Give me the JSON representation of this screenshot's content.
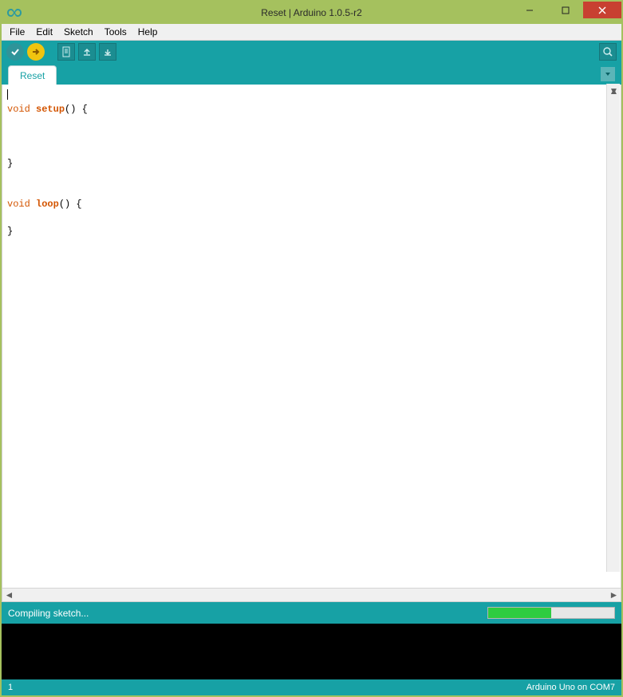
{
  "window": {
    "title": "Reset | Arduino 1.0.5-r2"
  },
  "menu": {
    "items": [
      "File",
      "Edit",
      "Sketch",
      "Tools",
      "Help"
    ]
  },
  "toolbar": {
    "verify_icon": "verify-icon",
    "upload_icon": "upload-icon",
    "new_icon": "new-icon",
    "open_icon": "open-icon",
    "save_icon": "save-icon",
    "serial_icon": "serial-monitor-icon"
  },
  "tabs": {
    "active": "Reset"
  },
  "code": {
    "line1_kw": "void",
    "line1_fn": "setup",
    "line1_rest": "() {",
    "line3": "  ",
    "line5": "}",
    "line8_kw": "void",
    "line8_fn": "loop",
    "line8_rest": "() {",
    "line10": "}"
  },
  "status": {
    "message": "Compiling sketch...",
    "progress_percent": 50
  },
  "footer": {
    "line_number": "1",
    "board_port": "Arduino Uno on COM7"
  }
}
